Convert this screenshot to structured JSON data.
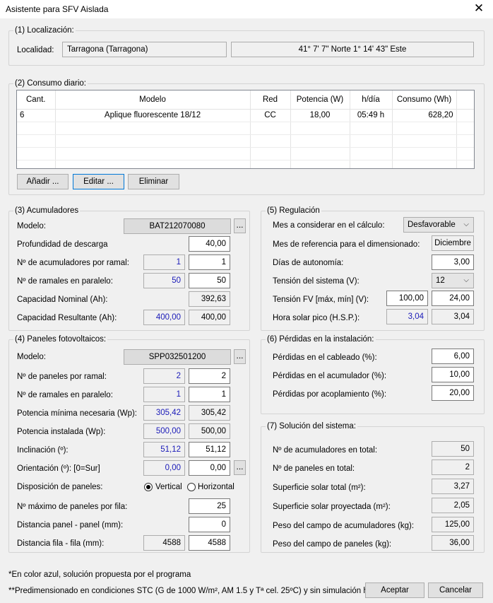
{
  "window": {
    "title": "Asistente para SFV Aislada",
    "close": "✕"
  },
  "loc": {
    "legend": "(1) Localización:",
    "label": "Localidad:",
    "city": "Tarragona (Tarragona)",
    "coords": "41° 7' 7\" Norte 1° 14' 43\" Este"
  },
  "consumo": {
    "legend": "(2) Consumo diario:",
    "headers": [
      "Cant.",
      "Modelo",
      "Red",
      "Potencia (W)",
      "h/día",
      "Consumo (Wh)"
    ],
    "rows": [
      [
        "6",
        "Aplique fluorescente 18/12",
        "CC",
        "18,00",
        "05:49 h",
        "628,20"
      ]
    ],
    "add": "Añadir ...",
    "edit": "Editar ...",
    "remove": "Eliminar"
  },
  "acum": {
    "legend": "(3) Acumuladores",
    "modelo_lbl": "Modelo:",
    "modelo": "BAT212070080",
    "dots": "...",
    "prof_lbl": "Profundidad de descarga",
    "prof": "40,00",
    "nacum_lbl": "Nº de acumuladores por ramal:",
    "nacum_calc": "1",
    "nacum": "1",
    "nram_lbl": "Nº de ramales en paralelo:",
    "nram_calc": "50",
    "nram": "50",
    "capnom_lbl": "Capacidad Nominal (Ah):",
    "capnom": "392,63",
    "capres_lbl": "Capacidad Resultante (Ah):",
    "capres_calc": "400,00",
    "capres": "400,00"
  },
  "regul": {
    "legend": "(5) Regulación",
    "mes_lbl": "Mes a considerar en el cálculo:",
    "mes": "Desfavorable",
    "mesref_lbl": "Mes de referencia para el dimensionado:",
    "mesref": "Diciembre",
    "dias_lbl": "Días de autonomía:",
    "dias": "3,00",
    "tension_lbl": "Tensión del sistema (V):",
    "tension": "12",
    "tfv_lbl": "Tensión FV [máx, mín] (V):",
    "tfv_max": "100,00",
    "tfv_min": "24,00",
    "hsp_lbl": "Hora solar pico (H.S.P.):",
    "hsp_calc": "3,04",
    "hsp": "3,04"
  },
  "panel": {
    "legend": "(4) Paneles fotovoltaicos:",
    "modelo_lbl": "Modelo:",
    "modelo": "SPP032501200",
    "dots": "...",
    "npan_lbl": "Nº de paneles por ramal:",
    "npan_calc": "2",
    "npan": "2",
    "nram_lbl": "Nº de ramales en paralelo:",
    "nram_calc": "1",
    "nram": "1",
    "potmin_lbl": "Potencia mínima necesaria (Wp):",
    "potmin_calc": "305,42",
    "potmin": "305,42",
    "potins_lbl": "Potencia instalada (Wp):",
    "potins_calc": "500,00",
    "potins": "500,00",
    "incl_lbl": "Inclinación (º):",
    "incl_calc": "51,12",
    "incl": "51,12",
    "orient_lbl": "Orientación (º): [0=Sur]",
    "orient_calc": "0,00",
    "orient": "0,00",
    "disp_lbl": "Disposición de paneles:",
    "vertical": "Vertical",
    "horizontal": "Horizontal",
    "maxfila_lbl": "Nº máximo de paneles por fila:",
    "maxfila": "25",
    "dpanel_lbl": "Distancia panel - panel (mm):",
    "dpanel": "0",
    "dfila_lbl": "Distancia fila - fila (mm):",
    "dfila_calc": "4588",
    "dfila": "4588"
  },
  "perd": {
    "legend": "(6) Pérdidas en la instalación:",
    "cab_lbl": "Pérdidas en el cableado (%):",
    "cab": "6,00",
    "acu_lbl": "Pérdidas en el acumulador (%):",
    "acu": "10,00",
    "aco_lbl": "Pérdidas por acoplamiento (%):",
    "aco": "20,00"
  },
  "sol": {
    "legend": "(7) Solución del sistema:",
    "nacu_lbl": "Nº de acumuladores en total:",
    "nacu": "50",
    "npan_lbl": "Nº de paneles en total:",
    "npan": "2",
    "sup_lbl": "Superficie solar total (m²):",
    "sup": "3,27",
    "supp_lbl": "Superficie solar proyectada (m²):",
    "supp": "2,05",
    "pacu_lbl": "Peso del campo de acumuladores (kg):",
    "pacu": "125,00",
    "ppan_lbl": "Peso del campo de paneles (kg):",
    "ppan": "36,00"
  },
  "footer": {
    "note1": "*En color azul, solución propuesta por el programa",
    "note2": "**Predimensionado en condiciones STC (G de 1000 W/m², AM 1.5 y Tª cel. 25ºC) y sin simulación horaria",
    "ok": "Aceptar",
    "cancel": "Cancelar"
  }
}
